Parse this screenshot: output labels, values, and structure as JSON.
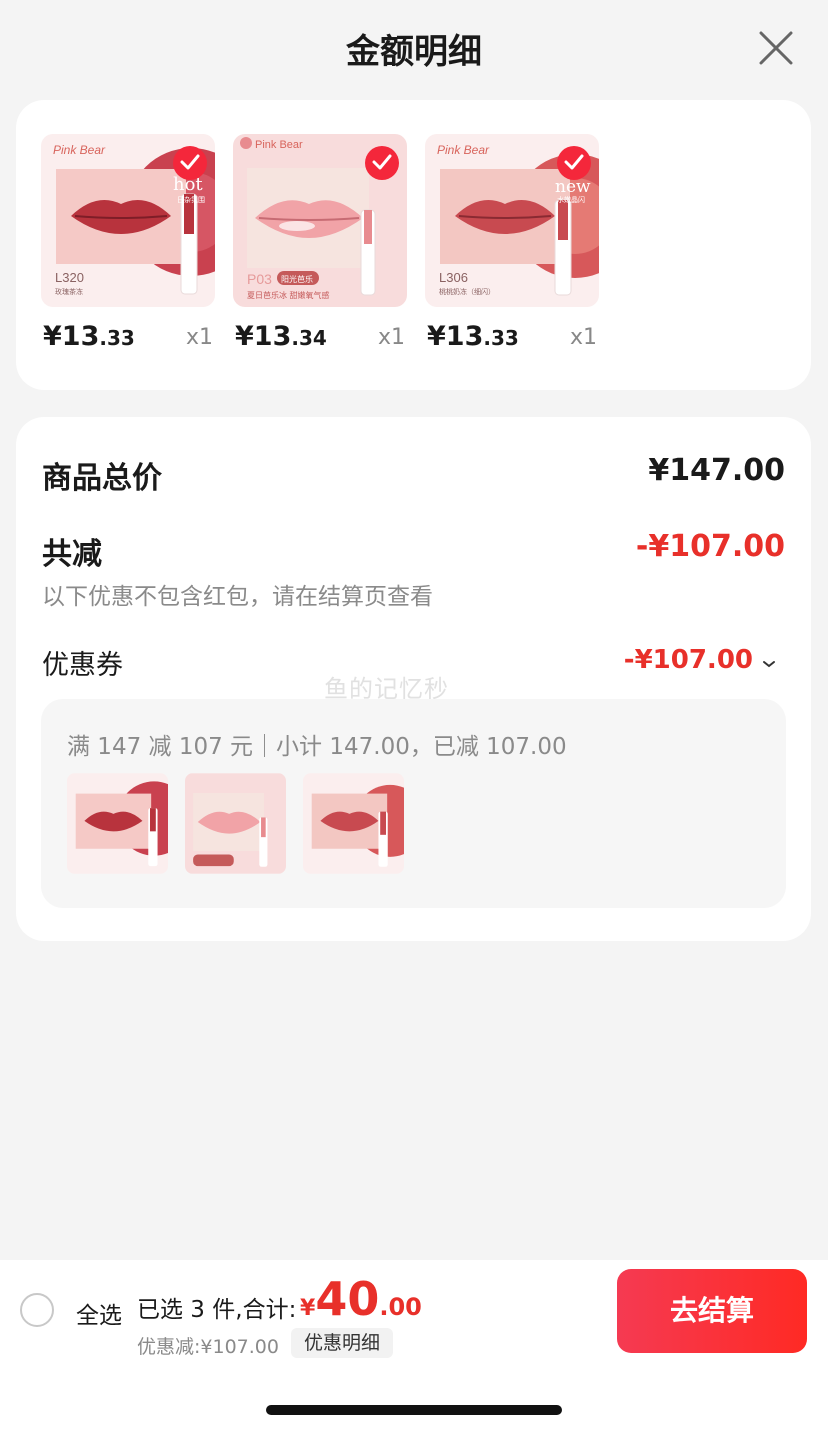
{
  "header": {
    "title": "金额明细",
    "close_icon": "close-icon"
  },
  "products": [
    {
      "brand": "Pink Bear",
      "tag": "hot",
      "tag_sub": "日杂氛围",
      "code": "L320",
      "shade": "玫瑰茶冻",
      "price_int": "¥13",
      "price_dec": ".33",
      "qty": "x1",
      "checked": true
    },
    {
      "brand": "Pink Bear",
      "tag": "",
      "tag_sub": "",
      "code": "P03",
      "badge": "阳光芭乐",
      "shade": "夏日芭乐冰 甜嫩氧气感",
      "price_int": "¥13",
      "price_dec": ".34",
      "qty": "x1",
      "checked": true
    },
    {
      "brand": "Pink Bear",
      "tag": "new",
      "tag_sub": "水嫩晶闪",
      "code": "L306",
      "shade": "桃桃奶冻（细闪）",
      "price_int": "¥13",
      "price_dec": ".33",
      "qty": "x1",
      "checked": true
    }
  ],
  "summary": {
    "total_label": "商品总价",
    "total_value": "¥147.00",
    "reduce_label": "共减",
    "reduce_value": "-¥107.00",
    "reduce_note": "以下优惠不包含红包，请在结算页查看",
    "coupon_label": "优惠券",
    "coupon_value": "-¥107.00",
    "watermark": "鱼的记忆秒",
    "coupon_desc": "满 147 减 107 元｜小计 147.00，已减 107.00"
  },
  "bottom_bar": {
    "select_all": "全选",
    "selected_text": "已选 3 件,合计:",
    "total_symbol": "¥",
    "total_int": "40",
    "total_dec": ".00",
    "discount_text": "优惠减:¥107.00",
    "detail_button": "优惠明细",
    "checkout_button": "去结算"
  },
  "colors": {
    "accent_red": "#e8302a",
    "check_red": "#f4273b",
    "background": "#f4f4f4"
  }
}
